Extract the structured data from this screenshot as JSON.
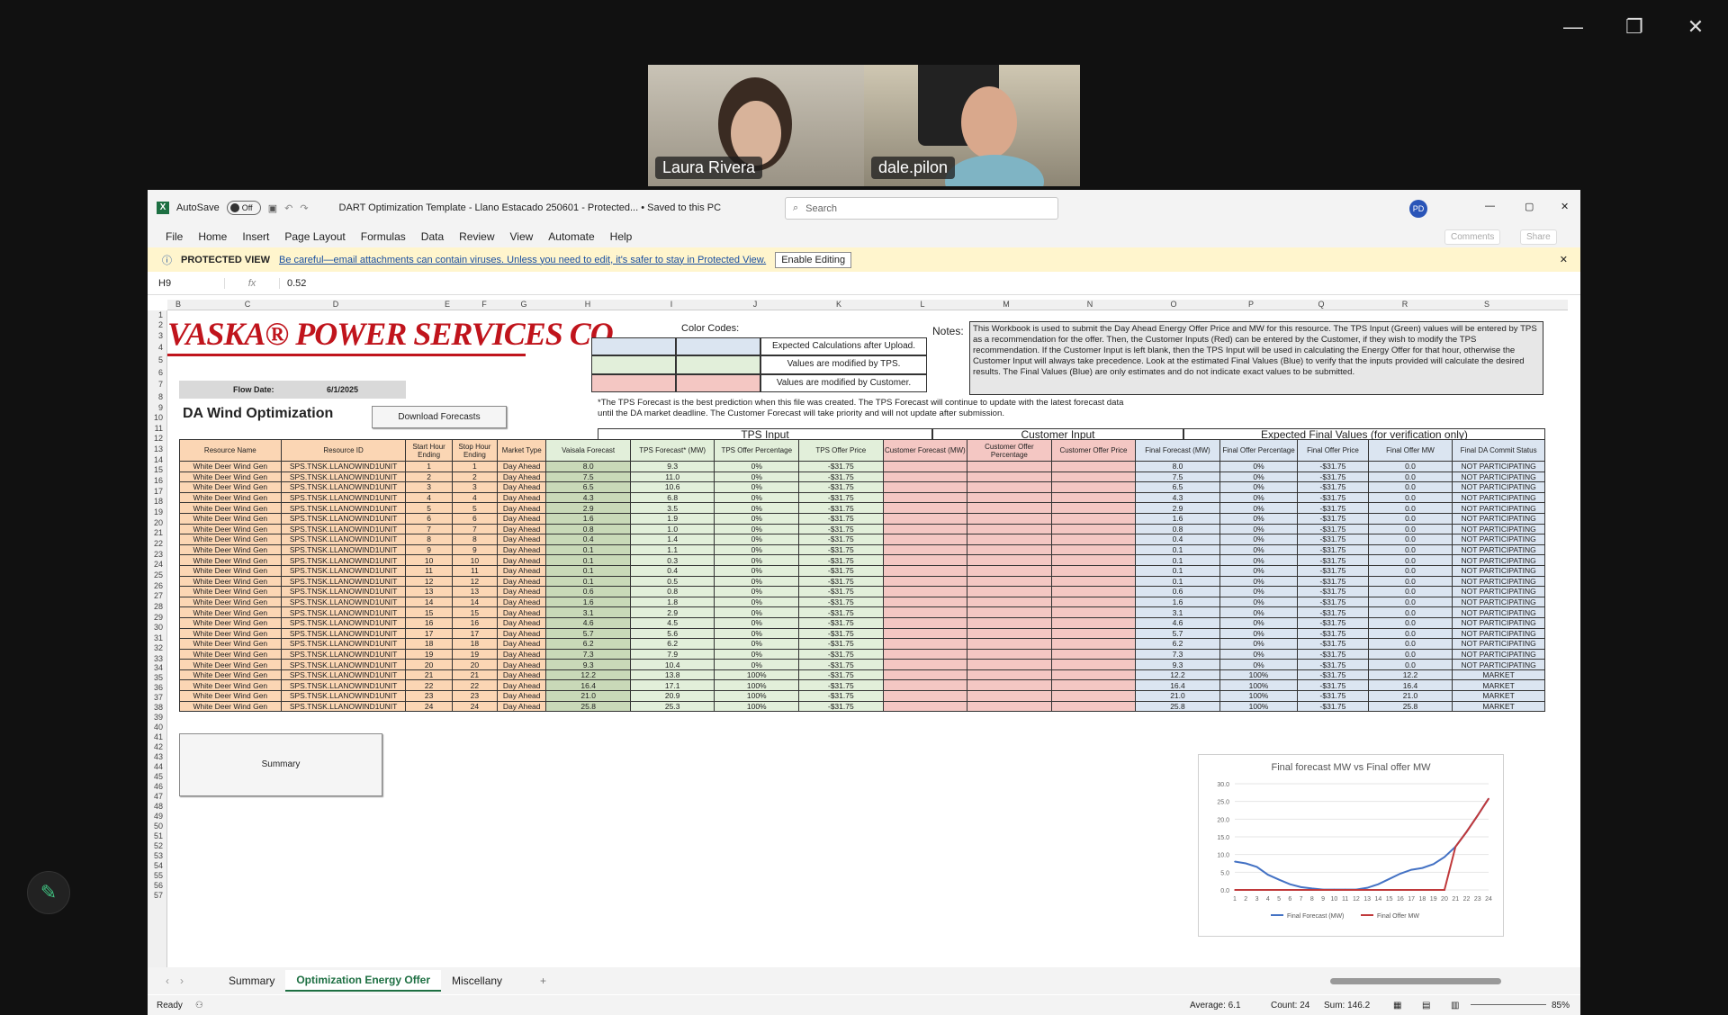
{
  "window_controls": {
    "minimize": "—",
    "restore": "❐",
    "close": "✕"
  },
  "video": [
    {
      "name": "Laura Rivera"
    },
    {
      "name": "dale.pilon"
    }
  ],
  "excel": {
    "autosave_label": "AutoSave",
    "autosave_state": "Off",
    "doc_title": "DART Optimization Template - Llano Estacado 250601  -  Protected...  •  Saved to this PC",
    "search_placeholder": "Search",
    "avatar": "PD",
    "menu": [
      "File",
      "Home",
      "Insert",
      "Page Layout",
      "Formulas",
      "Data",
      "Review",
      "View",
      "Automate",
      "Help"
    ],
    "comments": "Comments",
    "share": "Share",
    "protected_label": "PROTECTED VIEW",
    "protected_msg": "Be careful—email attachments can contain viruses. Unless you need to edit, it's safer to stay in Protected View.",
    "enable_editing": "Enable Editing",
    "namebox": "H9",
    "formula": "0.52",
    "col_letters": [
      "B",
      "C",
      "D",
      "E",
      "F",
      "G",
      "H",
      "I",
      "J",
      "K",
      "L",
      "M",
      "N",
      "O",
      "P",
      "Q",
      "R",
      "S"
    ],
    "row_numbers": [
      "1",
      "2",
      "3",
      "4",
      "5",
      "6",
      "7",
      "8",
      "9",
      "10",
      "11",
      "12",
      "13",
      "14",
      "15",
      "16",
      "17",
      "18",
      "19",
      "20",
      "21",
      "22",
      "23",
      "24",
      "25",
      "26",
      "27",
      "28",
      "29",
      "30",
      "31",
      "32",
      "33",
      "34",
      "35",
      "36",
      "37",
      "38",
      "39",
      "40",
      "41",
      "42",
      "43",
      "44",
      "45",
      "46",
      "47",
      "48",
      "49",
      "50",
      "51",
      "52",
      "53",
      "54",
      "55",
      "56",
      "57"
    ]
  },
  "sheet": {
    "logo": "VASKA® POWER SERVICES CO.",
    "flow_label": "Flow Date:",
    "flow_date": "6/1/2025",
    "title": "DA Wind Optimization",
    "download_btn": "Download Forecasts",
    "color_codes_title": "Color Codes:",
    "color_codes": [
      "Expected Calculations after Upload.",
      "Values are modified by TPS.",
      "Values are modified by Customer."
    ],
    "notes_label": "Notes:",
    "notes": "This Workbook is used to submit the Day Ahead Energy Offer Price and MW for this resource. The TPS Input (Green) values will be entered by TPS as a recommendation for the offer. Then, the Customer Inputs (Red) can be entered by the Customer, if they wish to modify the TPS recommendation. If the Customer Input is left blank, then the TPS Input will be used in calculating the Energy Offer for that hour, otherwise the Customer Input will always take precedence. Look at the estimated Final Values (Blue) to verify that the inputs provided will calculate the desired results. The Final Values (Blue) are only estimates and do not indicate exact values to be submitted.",
    "footnote1": "*The TPS Forecast is the best prediction when this file was created. The TPS Forecast will continue to update with the latest forecast data",
    "footnote2": "until the DA market deadline. The Customer Forecast will take priority and will not update after submission.",
    "sections": {
      "tps": "TPS Input",
      "customer": "Customer Input",
      "expected": "Expected Final Values (for verification only)"
    },
    "headers": [
      "Resource Name",
      "Resource ID",
      "Start Hour Ending",
      "Stop Hour Ending",
      "Market Type",
      "Vaisala Forecast",
      "TPS Forecast* (MW)",
      "TPS Offer Percentage",
      "TPS Offer Price",
      "Customer Forecast (MW)",
      "Customer Offer Percentage",
      "Customer Offer Price",
      "Final Forecast (MW)",
      "Final Offer Percentage",
      "Final Offer Price",
      "Final Offer MW",
      "Final DA Commit Status"
    ],
    "resource_name": "White Deer Wind Gen",
    "resource_id": "SPS.TNSK.LLANOWIND1UNIT",
    "market": "Day Ahead",
    "price": "-$31.75",
    "vaisala": [
      "8.0",
      "7.5",
      "6.5",
      "4.3",
      "2.9",
      "1.6",
      "0.8",
      "0.4",
      "0.1",
      "0.1",
      "0.1",
      "0.1",
      "0.6",
      "1.6",
      "3.1",
      "4.6",
      "5.7",
      "6.2",
      "7.3",
      "9.3",
      "12.2",
      "16.4",
      "21.0",
      "25.8"
    ],
    "tps_fc": [
      "9.3",
      "11.0",
      "10.6",
      "6.8",
      "3.5",
      "1.9",
      "1.0",
      "1.4",
      "1.1",
      "0.3",
      "0.4",
      "0.5",
      "0.8",
      "1.8",
      "2.9",
      "4.5",
      "5.6",
      "6.2",
      "7.9",
      "10.4",
      "13.8",
      "17.1",
      "20.9",
      "25.3"
    ],
    "pct": [
      "0%",
      "0%",
      "0%",
      "0%",
      "0%",
      "0%",
      "0%",
      "0%",
      "0%",
      "0%",
      "0%",
      "0%",
      "0%",
      "0%",
      "0%",
      "0%",
      "0%",
      "0%",
      "0%",
      "0%",
      "100%",
      "100%",
      "100%",
      "100%"
    ],
    "offer_mw": [
      "0.0",
      "0.0",
      "0.0",
      "0.0",
      "0.0",
      "0.0",
      "0.0",
      "0.0",
      "0.0",
      "0.0",
      "0.0",
      "0.0",
      "0.0",
      "0.0",
      "0.0",
      "0.0",
      "0.0",
      "0.0",
      "0.0",
      "0.0",
      "12.2",
      "16.4",
      "21.0",
      "25.8"
    ],
    "status": [
      "NOT PARTICIPATING",
      "NOT PARTICIPATING",
      "NOT PARTICIPATING",
      "NOT PARTICIPATING",
      "NOT PARTICIPATING",
      "NOT PARTICIPATING",
      "NOT PARTICIPATING",
      "NOT PARTICIPATING",
      "NOT PARTICIPATING",
      "NOT PARTICIPATING",
      "NOT PARTICIPATING",
      "NOT PARTICIPATING",
      "NOT PARTICIPATING",
      "NOT PARTICIPATING",
      "NOT PARTICIPATING",
      "NOT PARTICIPATING",
      "NOT PARTICIPATING",
      "NOT PARTICIPATING",
      "NOT PARTICIPATING",
      "NOT PARTICIPATING",
      "MARKET",
      "MARKET",
      "MARKET",
      "MARKET"
    ],
    "summary_btn": "Summary"
  },
  "chart_data": {
    "type": "line",
    "title": "Final forecast MW vs Final offer MW",
    "categories": [
      "1",
      "2",
      "3",
      "4",
      "5",
      "6",
      "7",
      "8",
      "9",
      "10",
      "11",
      "12",
      "13",
      "14",
      "15",
      "16",
      "17",
      "18",
      "19",
      "20",
      "21",
      "22",
      "23",
      "24"
    ],
    "series": [
      {
        "name": "Final Forecast (MW)",
        "color": "#4472c4",
        "values": [
          8.0,
          7.5,
          6.5,
          4.3,
          2.9,
          1.6,
          0.8,
          0.4,
          0.1,
          0.1,
          0.1,
          0.1,
          0.6,
          1.6,
          3.1,
          4.6,
          5.7,
          6.2,
          7.3,
          9.3,
          12.2,
          16.4,
          21.0,
          25.8
        ]
      },
      {
        "name": "Final Offer MW",
        "color": "#c0393b",
        "values": [
          0,
          0,
          0,
          0,
          0,
          0,
          0,
          0,
          0,
          0,
          0,
          0,
          0,
          0,
          0,
          0,
          0,
          0,
          0,
          0,
          12.2,
          16.4,
          21.0,
          25.8
        ]
      }
    ],
    "y_ticks": [
      "0.0",
      "5.0",
      "10.0",
      "15.0",
      "20.0",
      "25.0",
      "30.0"
    ],
    "ylim": [
      0,
      30
    ],
    "legend": "bottom"
  },
  "tabs": [
    "Summary",
    "Optimization Energy Offer",
    "Miscellany"
  ],
  "statusbar": {
    "ready": "Ready",
    "average": "Average: 6.1",
    "count": "Count: 24",
    "sum": "Sum: 146.2",
    "zoom": "85%"
  }
}
